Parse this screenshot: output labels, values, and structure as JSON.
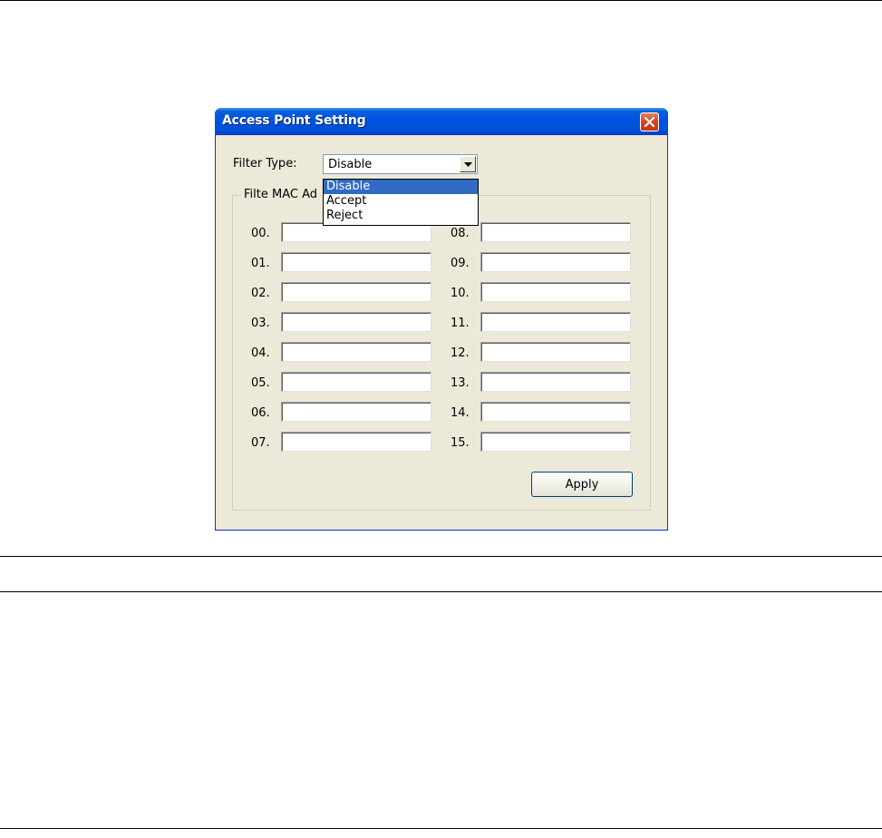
{
  "window": {
    "title": "Access Point Setting",
    "close_label": "close"
  },
  "filter": {
    "label": "Filter Type:",
    "selected": "Disable",
    "options": [
      "Disable",
      "Accept",
      "Reject"
    ]
  },
  "group": {
    "caption": "Filte MAC Ad"
  },
  "mac_entries_left": [
    {
      "num": "00.",
      "value": ""
    },
    {
      "num": "01.",
      "value": ""
    },
    {
      "num": "02.",
      "value": ""
    },
    {
      "num": "03.",
      "value": ""
    },
    {
      "num": "04.",
      "value": ""
    },
    {
      "num": "05.",
      "value": ""
    },
    {
      "num": "06.",
      "value": ""
    },
    {
      "num": "07.",
      "value": ""
    }
  ],
  "mac_entries_right": [
    {
      "num": "08.",
      "value": ""
    },
    {
      "num": "09.",
      "value": ""
    },
    {
      "num": "10.",
      "value": ""
    },
    {
      "num": "11.",
      "value": ""
    },
    {
      "num": "12.",
      "value": ""
    },
    {
      "num": "13.",
      "value": ""
    },
    {
      "num": "14.",
      "value": ""
    },
    {
      "num": "15.",
      "value": ""
    }
  ],
  "buttons": {
    "apply": "Apply"
  },
  "colors": {
    "titlebar": "#0054e3",
    "dialog_bg": "#ece9d8",
    "selection": "#316ac5",
    "close": "#d8431e"
  }
}
